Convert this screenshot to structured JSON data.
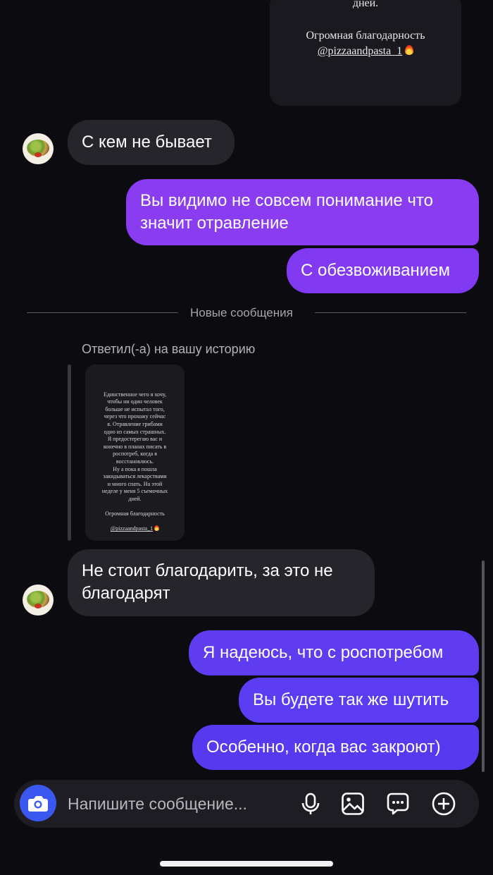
{
  "top_story_card": {
    "line1": "дней.",
    "line2": "Огромная благодарность",
    "line3": "@pizzaandpasta_1"
  },
  "messages": [
    {
      "from": "them",
      "text": "С кем не бывает"
    },
    {
      "from": "me",
      "text": "Вы видимо не совсем понимание что значит отравление"
    },
    {
      "from": "me",
      "text": "С обезвоживанием"
    }
  ],
  "divider": {
    "label": "Новые сообщения"
  },
  "story_reply": {
    "label": "Ответил(-а) на вашу историю",
    "story_text": "Единственное чего я хочу,\nчтобы ни один человек\nбольше не испытал того,\nчерез что прохожу сейчас\nя. Отравление грибами\nодно из самых страшных.\nЯ предостерегаю вас и\nконечно в планах писать в\nроспотреб, когда я\nвосстановлюсь.\nНу а пока я пошла\nзакидываться лекарствами\nи много спать. На этой\nнеделе у меня 5 съемочных\nдней.\n\nОгромная благодарность",
    "story_tag": "@pizzaandpasta_1"
  },
  "messages_after": [
    {
      "from": "them",
      "line1": "Не стоит благодарить, за это не",
      "line2": "благодарят"
    },
    {
      "from": "me",
      "text": "Я надеюсь, что с роспотребом"
    },
    {
      "from": "me",
      "text": "Вы будете так же шутить"
    },
    {
      "from": "me",
      "text": "Особенно, когда вас закроют)"
    }
  ],
  "composer": {
    "placeholder": "Напишите сообщение...",
    "icons": [
      "camera-icon",
      "microphone-icon",
      "gallery-icon",
      "sticker-icon",
      "plus-icon"
    ]
  },
  "colors": {
    "outgoing_purple": "#8a3cf0",
    "outgoing_blue": "#5b3cf2",
    "incoming": "#26252c",
    "camera_button": "#3a57f0"
  }
}
